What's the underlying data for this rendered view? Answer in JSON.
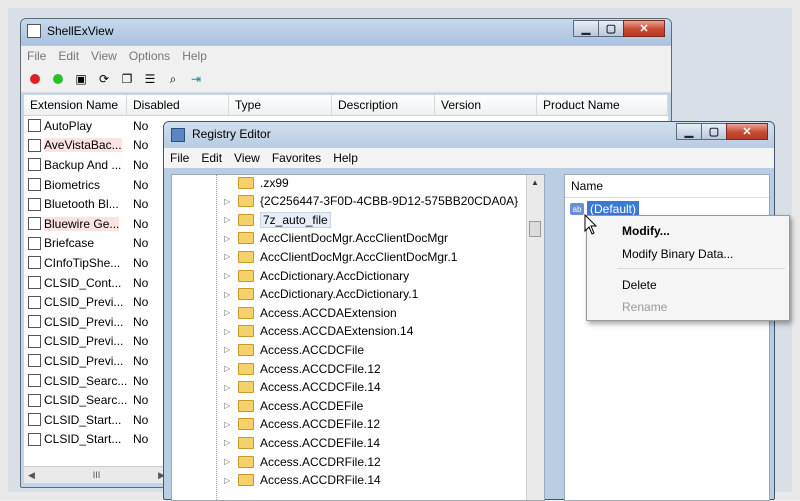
{
  "shellexview": {
    "title": "ShellExView",
    "menu": [
      "File",
      "Edit",
      "View",
      "Options",
      "Help"
    ],
    "columns": [
      "Extension Name",
      "Disabled",
      "Type",
      "Description",
      "Version",
      "Product Name"
    ],
    "rows": [
      {
        "name": "AutoPlay",
        "disabled": "No"
      },
      {
        "name": "AveVistaBac...",
        "disabled": "No"
      },
      {
        "name": "Backup And ...",
        "disabled": "No"
      },
      {
        "name": "Biometrics",
        "disabled": "No"
      },
      {
        "name": "Bluetooth Bl...",
        "disabled": "No"
      },
      {
        "name": "Bluewire Ge...",
        "disabled": "No"
      },
      {
        "name": "Briefcase",
        "disabled": "No"
      },
      {
        "name": "CInfoTipShe...",
        "disabled": "No"
      },
      {
        "name": "CLSID_Cont...",
        "disabled": "No"
      },
      {
        "name": "CLSID_Previ...",
        "disabled": "No"
      },
      {
        "name": "CLSID_Previ...",
        "disabled": "No"
      },
      {
        "name": "CLSID_Previ...",
        "disabled": "No"
      },
      {
        "name": "CLSID_Previ...",
        "disabled": "No"
      },
      {
        "name": "CLSID_Searc...",
        "disabled": "No"
      },
      {
        "name": "CLSID_Searc...",
        "disabled": "No"
      },
      {
        "name": "CLSID_Start...",
        "disabled": "No"
      },
      {
        "name": "CLSID_Start...",
        "disabled": "No"
      }
    ],
    "scroll_marker": "III"
  },
  "regedit": {
    "title": "Registry Editor",
    "menu": [
      "File",
      "Edit",
      "View",
      "Favorites",
      "Help"
    ],
    "keys": [
      ".zx99",
      "{2C256447-3F0D-4CBB-9D12-575BB20CDA0A}",
      "7z_auto_file",
      "AccClientDocMgr.AccClientDocMgr",
      "AccClientDocMgr.AccClientDocMgr.1",
      "AccDictionary.AccDictionary",
      "AccDictionary.AccDictionary.1",
      "Access.ACCDAExtension",
      "Access.ACCDAExtension.14",
      "Access.ACCDCFile",
      "Access.ACCDCFile.12",
      "Access.ACCDCFile.14",
      "Access.ACCDEFile",
      "Access.ACCDEFile.12",
      "Access.ACCDEFile.14",
      "Access.ACCDRFile.12",
      "Access.ACCDRFile.14"
    ],
    "name_header": "Name",
    "value_badge": "ab",
    "selected_value": "(Default)"
  },
  "context_menu": {
    "items": [
      "Modify...",
      "Modify Binary Data...",
      "Delete",
      "Rename"
    ]
  }
}
